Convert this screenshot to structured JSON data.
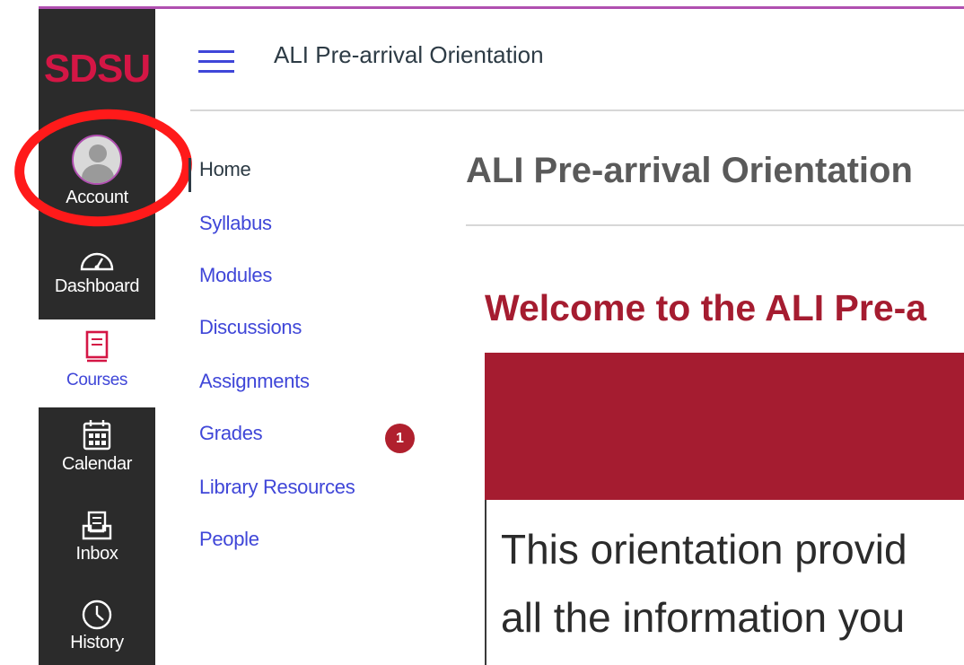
{
  "global_nav": {
    "logo": "SDSU",
    "items": [
      {
        "label": "Account",
        "icon": "user-avatar-icon"
      },
      {
        "label": "Dashboard",
        "icon": "speedometer-icon"
      },
      {
        "label": "Courses",
        "icon": "book-icon"
      },
      {
        "label": "Calendar",
        "icon": "calendar-icon"
      },
      {
        "label": "Inbox",
        "icon": "inbox-icon"
      },
      {
        "label": "History",
        "icon": "clock-icon"
      }
    ],
    "active": "Courses"
  },
  "header": {
    "menu_icon": "hamburger-icon",
    "course_title": "ALI Pre-arrival Orientation"
  },
  "course_nav": {
    "items": [
      {
        "label": "Home"
      },
      {
        "label": "Syllabus"
      },
      {
        "label": "Modules"
      },
      {
        "label": "Discussions"
      },
      {
        "label": "Assignments"
      },
      {
        "label": "Grades",
        "badge": "1"
      },
      {
        "label": "Library Resources"
      },
      {
        "label": "People"
      }
    ],
    "active": "Home"
  },
  "main": {
    "page_title": "ALI Pre-arrival Orientation",
    "welcome_heading": "Welcome to the ALI Pre-a",
    "content_lines": [
      "This orientation provid",
      "all the information you"
    ]
  },
  "colors": {
    "nav_bg": "#2b2b2b",
    "brand_red": "#d41645",
    "link_blue": "#3f46d8",
    "heading_red": "#a51c30",
    "annotation_red": "#ff1a1a"
  }
}
